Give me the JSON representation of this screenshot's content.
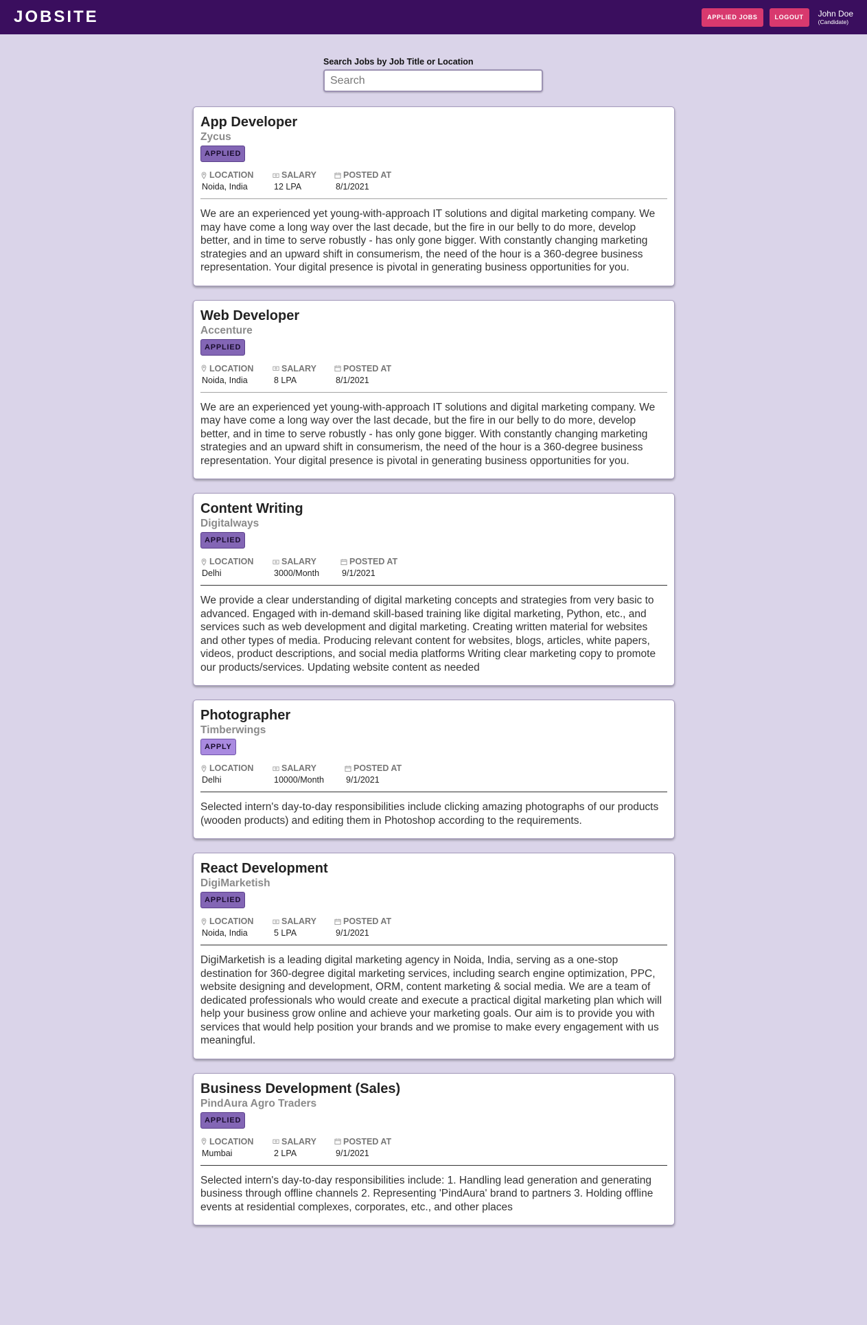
{
  "nav": {
    "brand": "JOBSITE",
    "applied_jobs": "APPLIED JOBS",
    "logout": "LOGOUT",
    "user_name": "John Doe",
    "user_role": "(Candidate)"
  },
  "search": {
    "label": "Search Jobs by Job Title or Location",
    "placeholder": "Search",
    "value": ""
  },
  "labels": {
    "location": "LOCATION",
    "salary": "SALARY",
    "posted_at": "POSTED AT"
  },
  "jobs": [
    {
      "title": "App Developer",
      "company": "Zycus",
      "status": "APPLIED",
      "location": "Noida, India",
      "salary": "12 LPA",
      "posted_at": "8/1/2021",
      "description": "We are an experienced yet young-with-approach IT solutions and digital marketing company. We may have come a long way over the last decade, but the fire in our belly to do more, develop better, and in time to serve robustly - has only gone bigger. With constantly changing marketing strategies and an upward shift in consumerism, the need of the hour is a 360-degree business representation. Your digital presence is pivotal in generating business opportunities for you."
    },
    {
      "title": "Web Developer",
      "company": "Accenture",
      "status": "APPLIED",
      "location": "Noida, India",
      "salary": "8 LPA",
      "posted_at": "8/1/2021",
      "description": "We are an experienced yet young-with-approach IT solutions and digital marketing company. We may have come a long way over the last decade, but the fire in our belly to do more, develop better, and in time to serve robustly - has only gone bigger. With constantly changing marketing strategies and an upward shift in consumerism, the need of the hour is a 360-degree business representation. Your digital presence is pivotal in generating business opportunities for you."
    },
    {
      "title": "Content Writing",
      "company": "Digitalways",
      "status": "APPLIED",
      "location": "Delhi",
      "salary": "3000/Month",
      "posted_at": "9/1/2021",
      "description": "We provide a clear understanding of digital marketing concepts and strategies from very basic to advanced. Engaged with in-demand skill-based training like digital marketing, Python, etc., and services such as web development and digital marketing. Creating written material for websites and other types of media. Producing relevant content for websites, blogs, articles, white papers, videos, product descriptions, and social media platforms Writing clear marketing copy to promote our products/services. Updating website content as needed"
    },
    {
      "title": "Photographer",
      "company": "Timberwings",
      "status": "APPLY",
      "location": "Delhi",
      "salary": "10000/Month",
      "posted_at": "9/1/2021",
      "description": "Selected intern's day-to-day responsibilities include clicking amazing photographs of our products (wooden products) and editing them in Photoshop according to the requirements."
    },
    {
      "title": "React Development",
      "company": "DigiMarketish",
      "status": "APPLIED",
      "location": "Noida, India",
      "salary": "5 LPA",
      "posted_at": "9/1/2021",
      "description": "DigiMarketish is a leading digital marketing agency in Noida, India, serving as a one-stop destination for 360-degree digital marketing services, including search engine optimization, PPC, website designing and development, ORM, content marketing & social media. We are a team of dedicated professionals who would create and execute a practical digital marketing plan which will help your business grow online and achieve your marketing goals. Our aim is to provide you with services that would help position your brands and we promise to make every engagement with us meaningful."
    },
    {
      "title": "Business Development (Sales)",
      "company": "PindAura Agro Traders",
      "status": "APPLIED",
      "location": "Mumbai",
      "salary": "2 LPA",
      "posted_at": "9/1/2021",
      "description": "Selected intern's day-to-day responsibilities include: 1. Handling lead generation and generating business through offline channels 2. Representing 'PindAura' brand to partners 3. Holding offline events at residential complexes, corporates, etc., and other places"
    }
  ]
}
